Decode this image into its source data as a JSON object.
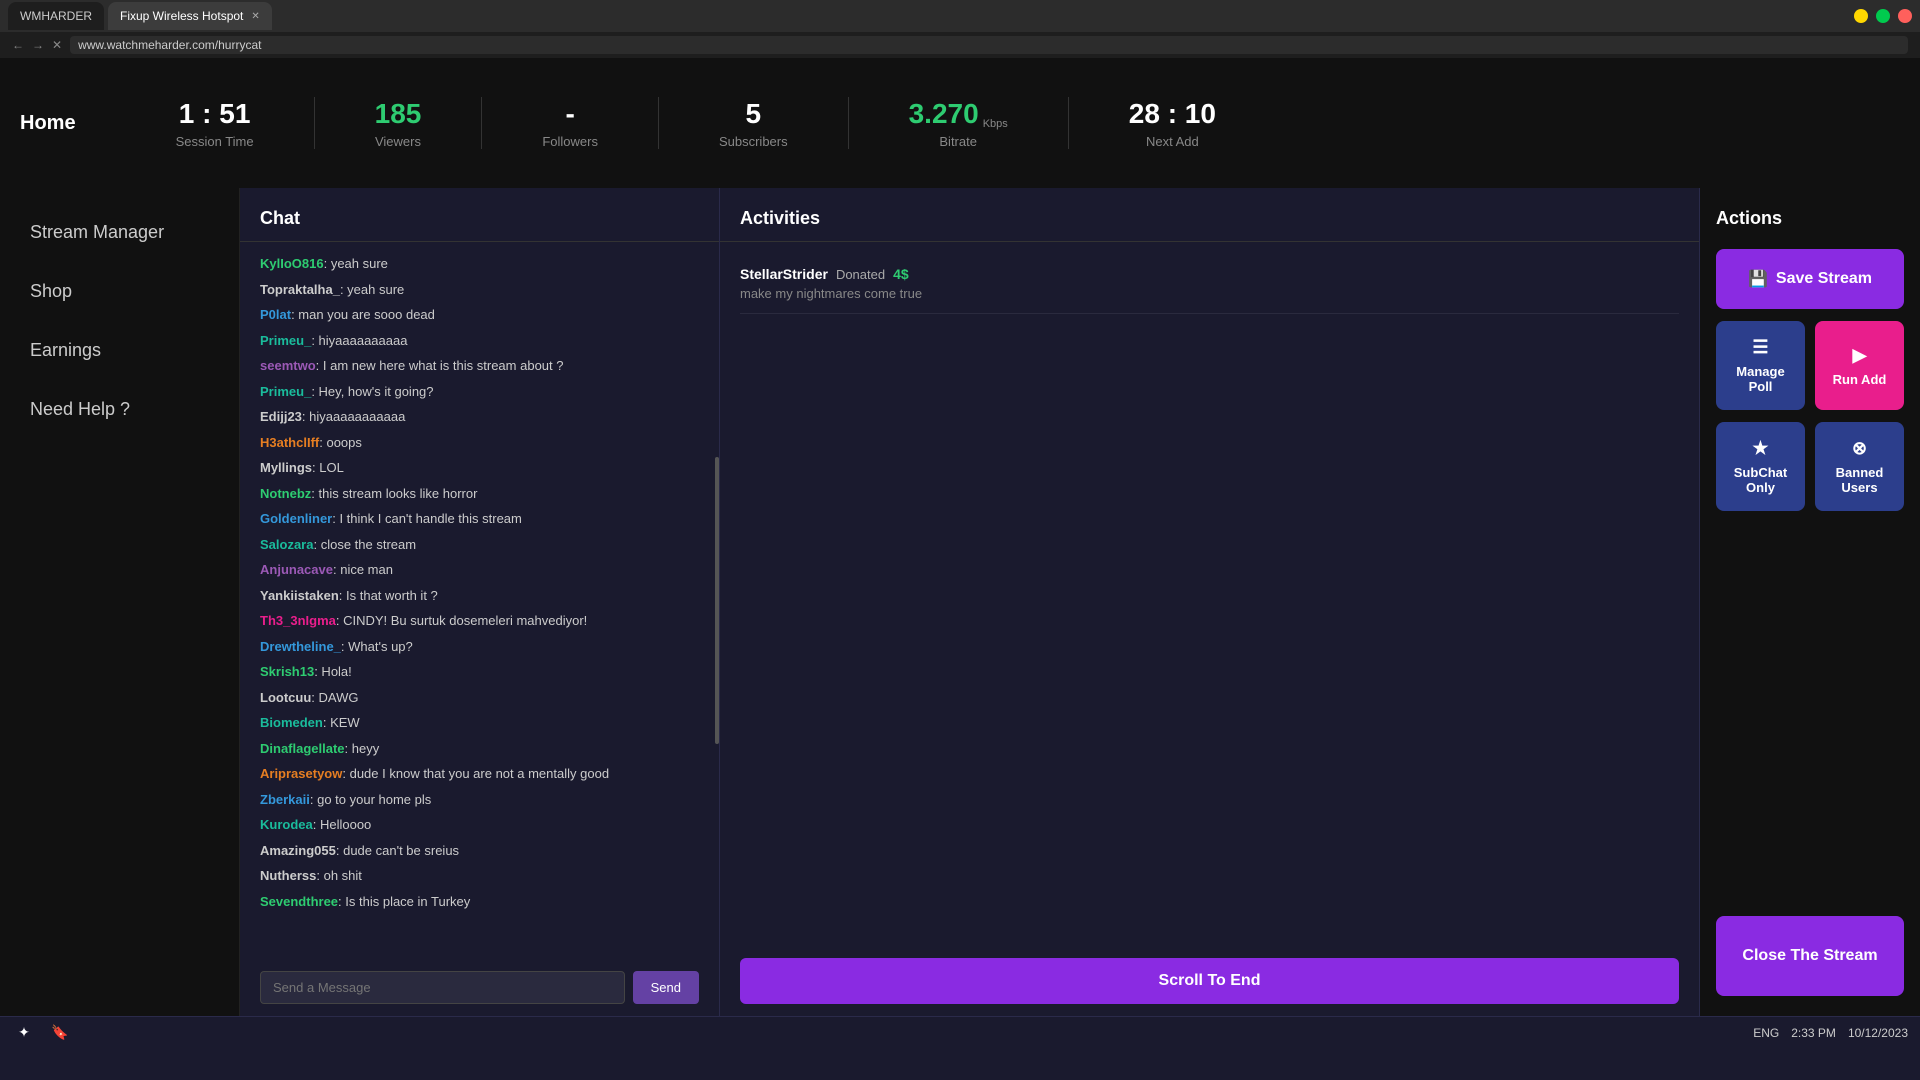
{
  "browser": {
    "tab_inactive": "WMHARDER",
    "tab_active": "Fixup Wireless Hotspot",
    "url": "www.watchmeharder.com/hurrycat",
    "close_symbol": "✕"
  },
  "header": {
    "home_label": "Home",
    "stats": [
      {
        "id": "session-time",
        "value": "1 : 51",
        "label": "Session Time",
        "color": "white"
      },
      {
        "id": "viewers",
        "value": "185",
        "label": "Viewers",
        "color": "green"
      },
      {
        "id": "followers",
        "value": "-",
        "label": "Followers",
        "color": "white"
      },
      {
        "id": "subscribers",
        "value": "5",
        "label": "Subscribers",
        "color": "white"
      },
      {
        "id": "bitrate",
        "value": "3.270",
        "label": "Bitrate",
        "color": "green",
        "unit": "Kbps"
      },
      {
        "id": "next-add",
        "value": "28 : 10",
        "label": "Next Add",
        "color": "white"
      }
    ]
  },
  "sidebar": {
    "items": [
      {
        "id": "stream-manager",
        "label": "Stream Manager"
      },
      {
        "id": "shop",
        "label": "Shop"
      },
      {
        "id": "earnings",
        "label": "Earnings"
      },
      {
        "id": "need-help",
        "label": "Need Help ?"
      }
    ]
  },
  "chat": {
    "header": "Chat",
    "messages": [
      {
        "username": "KylIoO816",
        "color": "green",
        "text": ": yeah sure"
      },
      {
        "username": "Topraktalha_",
        "color": "default",
        "text": ": yeah sure"
      },
      {
        "username": "P0lat",
        "color": "blue",
        "text": ": man you are sooo dead"
      },
      {
        "username": "Primeu_",
        "color": "cyan",
        "text": ": hiyaaaaaaaaaa"
      },
      {
        "username": "seemtwo",
        "color": "purple",
        "text": ": I am new here what is this stream about ?"
      },
      {
        "username": "Primeu_",
        "color": "cyan",
        "text": ": Hey, how's it going?"
      },
      {
        "username": "Edijj23",
        "color": "default",
        "text": ": hiyaaaaaaaaaaa"
      },
      {
        "username": "H3athclIff",
        "color": "orange",
        "text": ": ooops"
      },
      {
        "username": "Myllings",
        "color": "default",
        "text": ": LOL"
      },
      {
        "username": "Notnebz",
        "color": "green",
        "text": ": this stream looks like horror"
      },
      {
        "username": "Goldenliner",
        "color": "blue",
        "text": ": I think I can't handle this stream"
      },
      {
        "username": "Salozara",
        "color": "cyan",
        "text": ": close the stream"
      },
      {
        "username": "Anjunacave",
        "color": "purple",
        "text": ": nice man"
      },
      {
        "username": "Yankiistaken",
        "color": "default",
        "text": ": Is that worth it ?"
      },
      {
        "username": "Th3_3nIgma",
        "color": "pink",
        "text": ": CINDY! Bu surtuk dosemeleri mahvediyor!"
      },
      {
        "username": "Drewtheline_",
        "color": "blue",
        "text": ": What's up?"
      },
      {
        "username": "Skrish13",
        "color": "green",
        "text": ": Hola!"
      },
      {
        "username": "Lootcuu",
        "color": "default",
        "text": ": DAWG"
      },
      {
        "username": "Biomeden",
        "color": "cyan",
        "text": ": KEW"
      },
      {
        "username": "Dinaflagellate",
        "color": "green",
        "text": ": heyy"
      },
      {
        "username": "Ariprasetyow",
        "color": "orange",
        "text": ": dude I know that you are not a mentally good"
      },
      {
        "username": "Zberkaii",
        "color": "blue",
        "text": ": go to your home pls"
      },
      {
        "username": "Kurodea",
        "color": "cyan",
        "text": ": Helloooo"
      },
      {
        "username": "Amazing055",
        "color": "default",
        "text": ": dude can't be sreius"
      },
      {
        "username": "Nutherss",
        "color": "default",
        "text": ": oh shit"
      },
      {
        "username": "Sevendthree",
        "color": "green",
        "text": ": Is this place in Turkey"
      }
    ],
    "input_placeholder": "Send a Message",
    "send_button": "Send"
  },
  "activities": {
    "header": "Activities",
    "items": [
      {
        "user": "StellarStrider",
        "action": "Donated",
        "amount": "4$",
        "message": "make my nightmares come true"
      }
    ],
    "scroll_to_end": "Scroll To End"
  },
  "actions": {
    "header": "Actions",
    "save_stream": "Save Stream",
    "manage_poll": "Manage Poll",
    "run_add": "Run Add",
    "subchat_only": "SubChat Only",
    "banned_users": "Banned Users",
    "close_stream": "Close The Stream",
    "icons": {
      "save": "💾",
      "manage": "≡",
      "run": "▶",
      "star": "★",
      "person_x": "⊗"
    }
  },
  "taskbar": {
    "left_icon1": "✦",
    "left_icon2": "🔖",
    "time": "2:33 PM",
    "date": "10/12/2023",
    "lang": "ENG"
  }
}
